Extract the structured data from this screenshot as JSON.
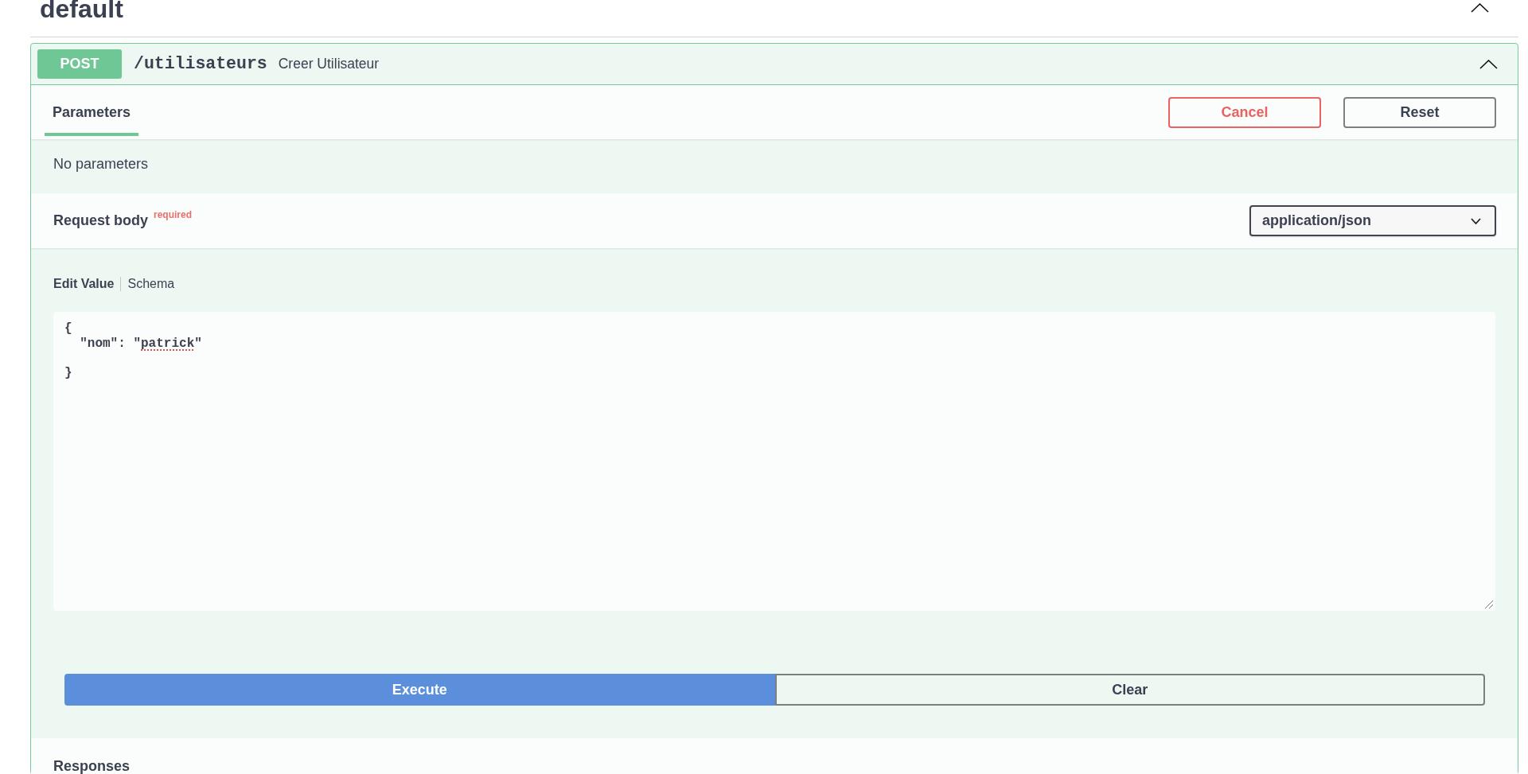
{
  "section": {
    "title": "default",
    "expanded": true
  },
  "operation": {
    "method": "POST",
    "path": "/utilisateurs",
    "summary": "Creer Utilisateur",
    "expanded": true
  },
  "tabs": [
    {
      "label": "Parameters",
      "selected": true
    }
  ],
  "tab_buttons": [
    {
      "label": "Cancel",
      "kind": "cancel"
    },
    {
      "label": "Reset",
      "kind": "reset"
    }
  ],
  "parameters_message": "No parameters",
  "request_body": {
    "title": "Request body",
    "required_label": "required",
    "media_type": "application/json",
    "editor_tabs": [
      {
        "label": "Edit Value",
        "selected": true
      },
      {
        "label": "Schema",
        "selected": false
      }
    ],
    "value": [
      {
        "text": "{\n  \"nom\": \"",
        "misspelled": false
      },
      {
        "text": "patrick",
        "misspelled": true
      },
      {
        "text": "\"\n\n}",
        "misspelled": false
      }
    ]
  },
  "actions": [
    {
      "label": "Execute",
      "kind": "execute"
    },
    {
      "label": "Clear",
      "kind": "clear"
    }
  ],
  "responses": {
    "title": "Responses"
  }
}
